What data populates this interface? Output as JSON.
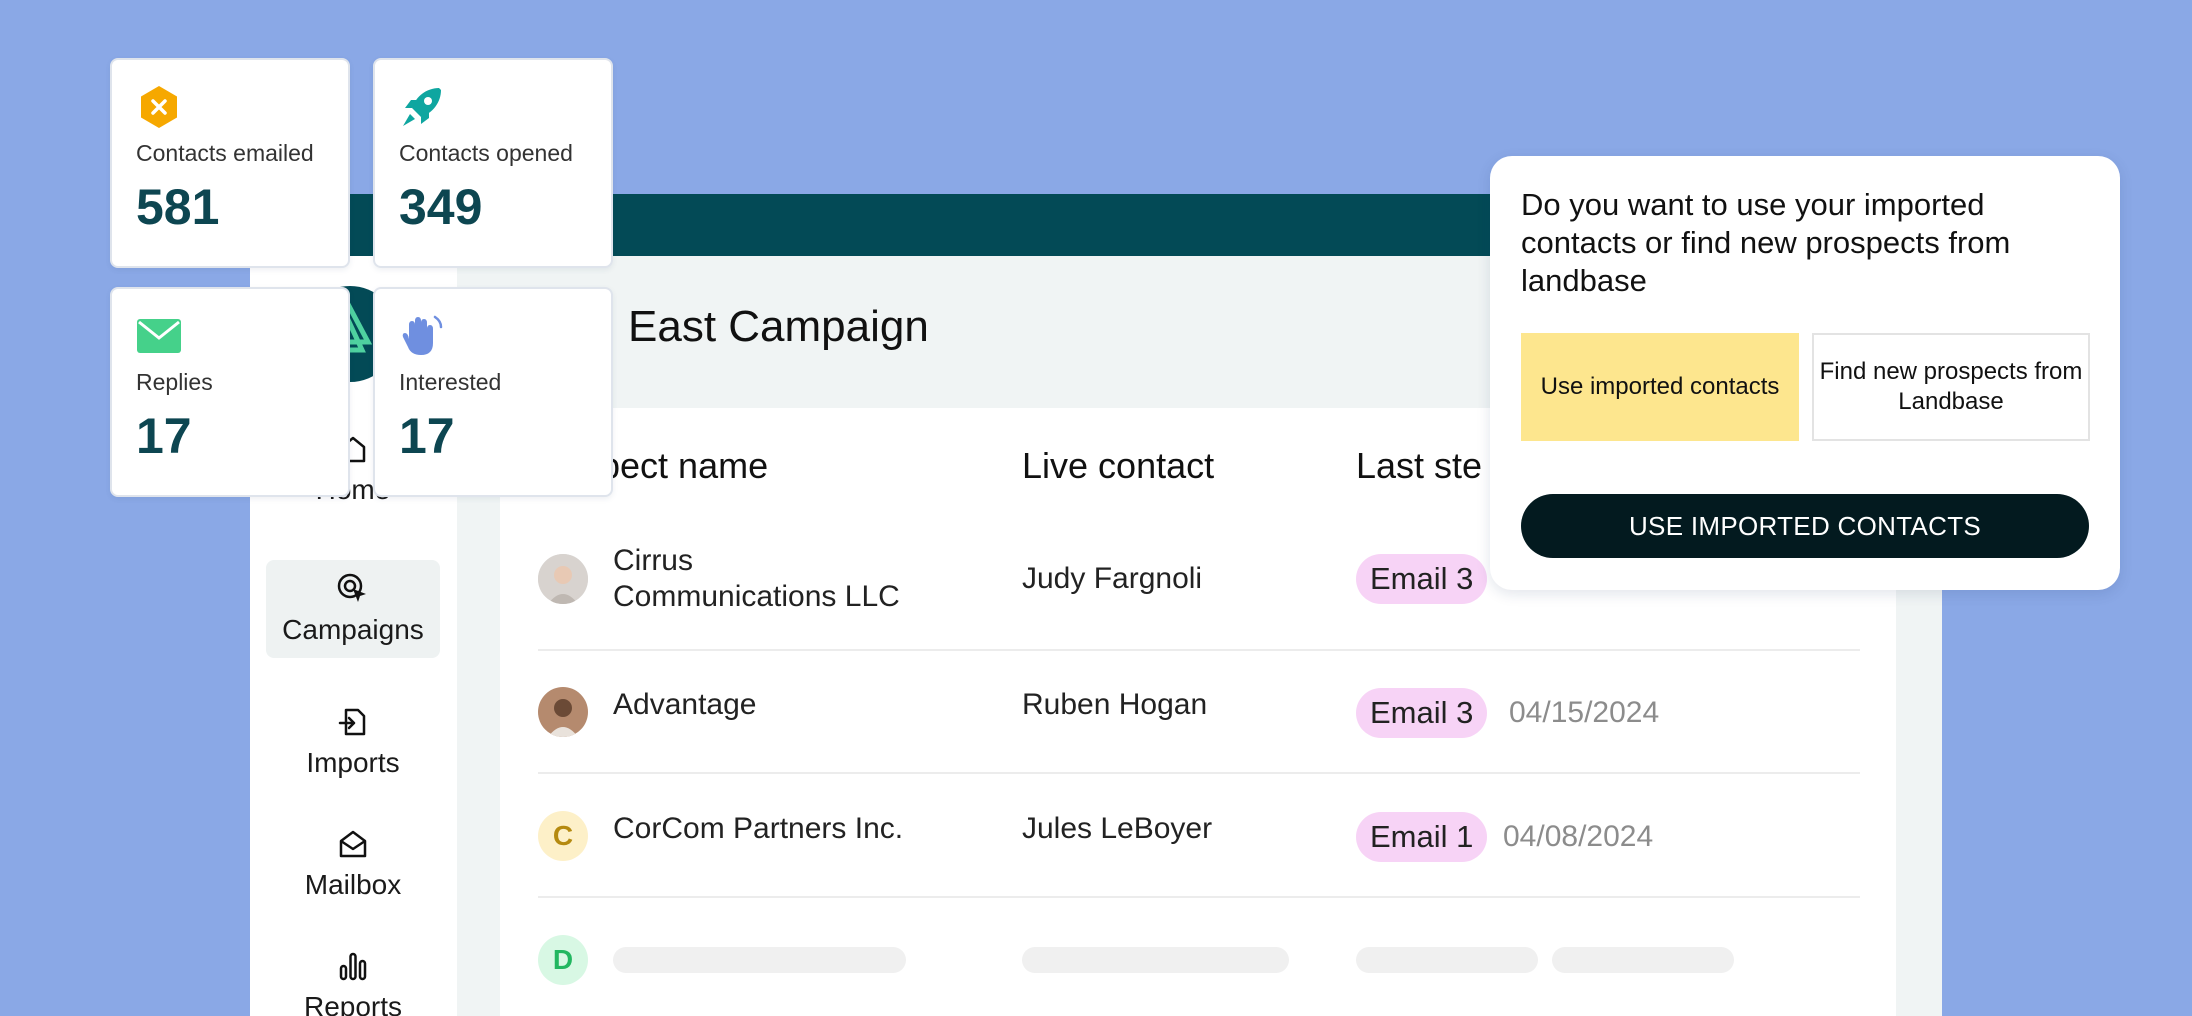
{
  "stats": [
    {
      "icon": "x-badge-icon",
      "label": "Contacts emailed",
      "value": "581",
      "color": "#f6a800"
    },
    {
      "icon": "rocket-icon",
      "label": "Contacts opened",
      "value": "349",
      "color": "#0fa6a0"
    },
    {
      "icon": "envelope-icon",
      "label": "Replies",
      "value": "17",
      "color": "#45d18a"
    },
    {
      "icon": "wave-hand-icon",
      "label": "Interested",
      "value": "17",
      "color": "#6f8fe0"
    }
  ],
  "sidebar": {
    "items": [
      {
        "label": "Home",
        "icon": "home-icon"
      },
      {
        "label": "Campaigns",
        "icon": "target-cursor-icon",
        "active": true
      },
      {
        "label": "Imports",
        "icon": "import-icon"
      },
      {
        "label": "Mailbox",
        "icon": "mailbox-icon"
      },
      {
        "label": "Reports",
        "icon": "bar-chart-icon"
      }
    ]
  },
  "campaign": {
    "title": "East Campaign"
  },
  "table": {
    "headers": [
      "pect name",
      "Live contact",
      "Last ste"
    ],
    "rows": [
      {
        "name_line1": "Cirrus",
        "name_line2": "Communications LLC",
        "contact": "Judy Fargnoli",
        "step": "Email 3",
        "date": ""
      },
      {
        "name": "Advantage",
        "contact": "Ruben Hogan",
        "step": "Email 3",
        "date": "04/15/2024"
      },
      {
        "initial": "C",
        "name": "CorCom Partners Inc.",
        "contact": "Jules LeBoyer",
        "step": "Email 1",
        "date": "04/08/2024"
      },
      {
        "initial": "D"
      }
    ]
  },
  "prompt": {
    "question": "Do you want to use your imported contacts or find new prospects from landbase",
    "option_imported": "Use imported contacts",
    "option_new": "Find new prospects from Landbase",
    "primary_button": "USE IMPORTED CONTACTS"
  },
  "colors": {
    "background": "#8aa8e6",
    "topbar": "#034a56",
    "email_pill": "#f7d3f6",
    "selected_option": "#fde68e",
    "primary_button": "#031a1f"
  }
}
